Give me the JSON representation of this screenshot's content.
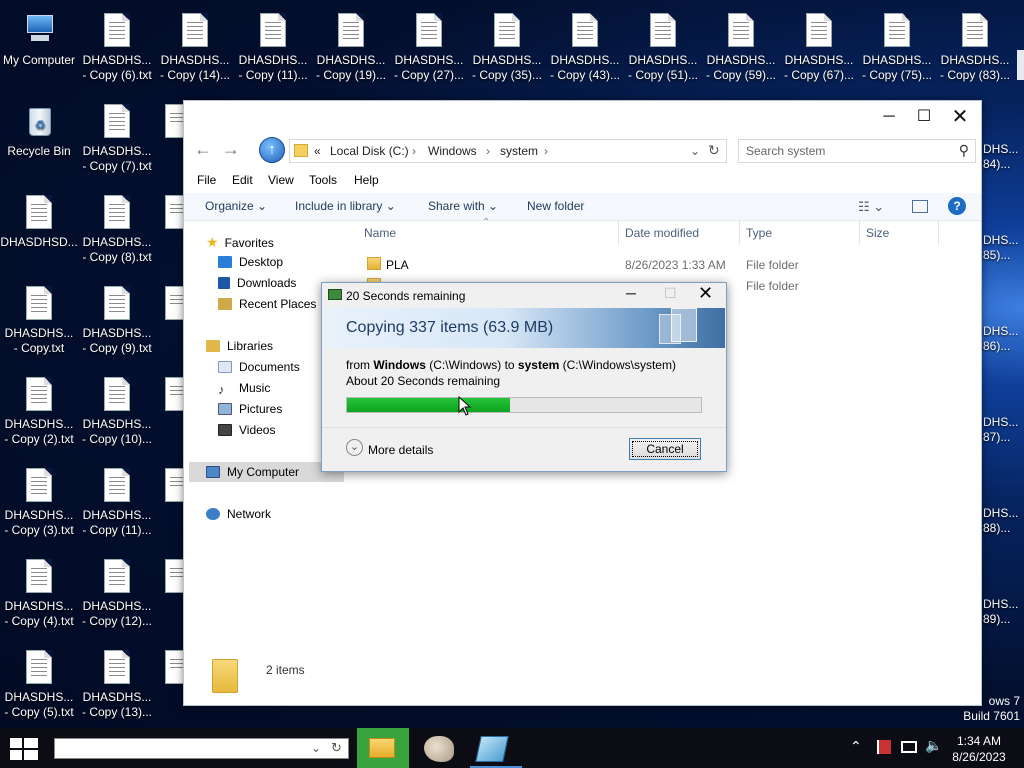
{
  "desktop": {
    "col1": [
      {
        "label1": "My Computer",
        "label2": ""
      },
      {
        "label1": "Recycle Bin",
        "label2": ""
      },
      {
        "label1": "DHASDHSD...",
        "label2": ""
      },
      {
        "label1": "DHASDHS...",
        "label2": "- Copy.txt"
      },
      {
        "label1": "DHASDHS...",
        "label2": "- Copy (2).txt"
      },
      {
        "label1": "DHASDHS...",
        "label2": "- Copy (3).txt"
      },
      {
        "label1": "DHASDHS...",
        "label2": "- Copy (4).txt"
      },
      {
        "label1": "DHASDHS...",
        "label2": "- Copy (5).txt"
      }
    ],
    "col2": [
      {
        "label1": "DHASDHS...",
        "label2": "- Copy (6).txt"
      },
      {
        "label1": "DHASDHS...",
        "label2": "- Copy (7).txt"
      },
      {
        "label1": "DHASDHS...",
        "label2": "- Copy (8).txt"
      },
      {
        "label1": "DHASDHS...",
        "label2": "- Copy (9).txt"
      },
      {
        "label1": "DHASDHS...",
        "label2": "- Copy (10)..."
      },
      {
        "label1": "DHASDHS...",
        "label2": "- Copy (11)..."
      },
      {
        "label1": "DHASDHS...",
        "label2": "- Copy (12)..."
      },
      {
        "label1": "DHASDHS...",
        "label2": "- Copy (13)..."
      }
    ],
    "top": [
      {
        "label1": "DHASDHS...",
        "label2": "- Copy (14)..."
      },
      {
        "label1": "DHASDHS...",
        "label2": "- Copy (11)..."
      },
      {
        "label1": "DHASDHS...",
        "label2": "- Copy (19)..."
      },
      {
        "label1": "DHASDHS...",
        "label2": "- Copy (27)..."
      },
      {
        "label1": "DHASDHS...",
        "label2": "- Copy (35)..."
      },
      {
        "label1": "DHASDHS...",
        "label2": "- Copy (43)..."
      },
      {
        "label1": "DHASDHS...",
        "label2": "- Copy (51)..."
      },
      {
        "label1": "DHASDHS...",
        "label2": "- Copy (59)..."
      },
      {
        "label1": "DHASDHS...",
        "label2": "- Copy (67)..."
      },
      {
        "label1": "DHASDHS...",
        "label2": "- Copy (75)..."
      },
      {
        "label1": "DHASDHS...",
        "label2": "- Copy (83)..."
      }
    ],
    "right_edge": [
      "84)...",
      "85)...",
      "86)...",
      "87)...",
      "88)...",
      "89)..."
    ],
    "right_edge_prefix": "DHS...",
    "watermark": {
      "line1": "ows 7",
      "line2": "Build 7601"
    }
  },
  "explorer": {
    "address": {
      "chev": "«",
      "seg1": "Local Disk (C:)",
      "seg2": "Windows",
      "seg3": "system"
    },
    "search_placeholder": "Search system",
    "menu": [
      "File",
      "Edit",
      "View",
      "Tools",
      "Help"
    ],
    "commands": {
      "organize": "Organize",
      "include": "Include in library",
      "share": "Share with",
      "new_folder": "New folder"
    },
    "nav": {
      "favorites": "Favorites",
      "desktop": "Desktop",
      "downloads": "Downloads",
      "recent": "Recent Places",
      "libraries": "Libraries",
      "documents": "Documents",
      "music": "Music",
      "pictures": "Pictures",
      "videos": "Videos",
      "computer": "My Computer",
      "network": "Network"
    },
    "columns": {
      "name": "Name",
      "date": "Date modified",
      "type": "Type",
      "size": "Size"
    },
    "files": [
      {
        "name": "PLA",
        "date": "8/26/2023 1:33 AM",
        "type": "File folder"
      },
      {
        "name": "",
        "date": "",
        "type": "File folder"
      }
    ],
    "status": "2 items"
  },
  "dialog": {
    "title": "20 Seconds remaining",
    "heading": "Copying 337 items (63.9 MB)",
    "from_prefix": "from ",
    "from_name": "Windows",
    "from_path": " (C:\\Windows) to ",
    "to_name": "system",
    "to_path": " (C:\\Windows\\system)",
    "remaining": "About 20 Seconds remaining",
    "progress": 0.46,
    "more_details": "More details",
    "cancel": "Cancel"
  },
  "taskbar": {
    "time": "1:34 AM",
    "date": "8/26/2023"
  }
}
